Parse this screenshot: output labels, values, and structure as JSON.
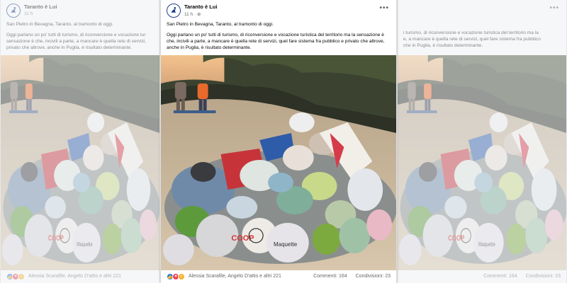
{
  "post": {
    "page_name": "Taranto è Lui",
    "time": "11 h",
    "location_line": "San Pietro in Bevagna, Taranto, al tramonto di oggi.",
    "body": "Oggi parlano un po' tutti di turismo, di riconversione e vocazione turistica del territorio ma la sensazione è che, incivili a parte, a mancare è quella rete di servizi, quel fare sistema fra pubblico e privato che altrove, anche in Puglia, è risultato determinante.",
    "body_left": "Oggi parlano un po' tutti di turismo, di riconversione e vocazione tur",
    "body_left2": "sensazione è che, incivili a parte, a mancare è quella rete di servizi,",
    "body_left3": "privato che altrove, anche in Puglia, è risultato determinante.",
    "body_right1": "i turismo, di riconversione e vocazione turistica del territorio ma la",
    "body_right2": "e, a mancare è quella rete di servizi, quel fare sistema fra pubblico",
    "body_right3": "che in Puglia, è risultato determinante.",
    "reactions": {
      "icons": [
        "like-icon",
        "love-icon",
        "care-icon"
      ],
      "names": "Alessia Scarafile, Angelo D'attis e altri 221"
    },
    "comments": "Commenti: 164",
    "shares": "Condivisioni: 23",
    "photo_labels": {
      "coop": "COOP",
      "maquette": "Maquette"
    }
  },
  "colors": {
    "facebook_blue": "#1877f2",
    "sky": "#e7b489",
    "sand": "#c9b79c"
  }
}
